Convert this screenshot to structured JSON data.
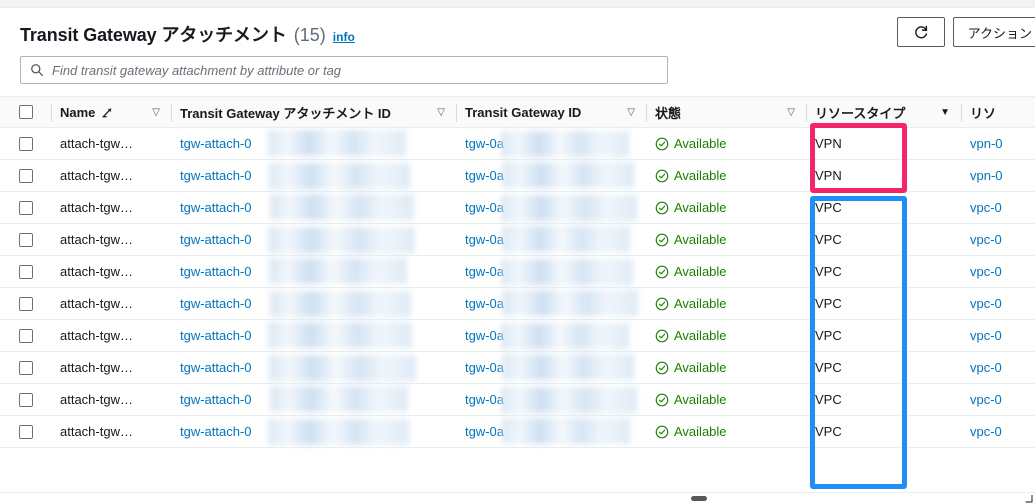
{
  "header": {
    "title": "Transit Gateway アタッチメント",
    "count": "(15)",
    "info_label": "info",
    "refresh_icon": "refresh-icon",
    "actions_label": "アクション"
  },
  "search": {
    "icon": "search-icon",
    "placeholder": "Find transit gateway attachment by attribute or tag",
    "value": ""
  },
  "table": {
    "select_all_label": "",
    "columns": [
      {
        "label": "Name",
        "sort": "▽",
        "sort_active": false,
        "has_pencil": true
      },
      {
        "label": "Transit Gateway アタッチメント ID",
        "sort": "▽",
        "sort_active": false,
        "has_pencil": false
      },
      {
        "label": "Transit Gateway ID",
        "sort": "▽",
        "sort_active": false,
        "has_pencil": false
      },
      {
        "label": "状態",
        "sort": "▽",
        "sort_active": false,
        "has_pencil": false
      },
      {
        "label": "リソースタイプ",
        "sort": "▼",
        "sort_active": true,
        "has_pencil": false
      },
      {
        "label": "リソ",
        "sort": "",
        "sort_active": false,
        "has_pencil": false
      }
    ],
    "rows": [
      {
        "name": "attach-tgw…",
        "attachment_id": "tgw-attach-0",
        "tgw_id": "tgw-0a",
        "state": "Available",
        "state_icon": "check-circle-icon",
        "resource_type": "VPN",
        "resource_id": "vpn-0"
      },
      {
        "name": "attach-tgw…",
        "attachment_id": "tgw-attach-0",
        "tgw_id": "tgw-0a",
        "state": "Available",
        "state_icon": "check-circle-icon",
        "resource_type": "VPN",
        "resource_id": "vpn-0"
      },
      {
        "name": "attach-tgw…",
        "attachment_id": "tgw-attach-0",
        "tgw_id": "tgw-0a",
        "state": "Available",
        "state_icon": "check-circle-icon",
        "resource_type": "VPC",
        "resource_id": "vpc-0"
      },
      {
        "name": "attach-tgw…",
        "attachment_id": "tgw-attach-0",
        "tgw_id": "tgw-0a",
        "state": "Available",
        "state_icon": "check-circle-icon",
        "resource_type": "VPC",
        "resource_id": "vpc-0"
      },
      {
        "name": "attach-tgw…",
        "attachment_id": "tgw-attach-0",
        "tgw_id": "tgw-0a",
        "state": "Available",
        "state_icon": "check-circle-icon",
        "resource_type": "VPC",
        "resource_id": "vpc-0"
      },
      {
        "name": "attach-tgw…",
        "attachment_id": "tgw-attach-0",
        "tgw_id": "tgw-0a",
        "state": "Available",
        "state_icon": "check-circle-icon",
        "resource_type": "VPC",
        "resource_id": "vpc-0"
      },
      {
        "name": "attach-tgw…",
        "attachment_id": "tgw-attach-0",
        "tgw_id": "tgw-0a",
        "state": "Available",
        "state_icon": "check-circle-icon",
        "resource_type": "VPC",
        "resource_id": "vpc-0"
      },
      {
        "name": "attach-tgw…",
        "attachment_id": "tgw-attach-0",
        "tgw_id": "tgw-0a",
        "state": "Available",
        "state_icon": "check-circle-icon",
        "resource_type": "VPC",
        "resource_id": "vpc-0"
      },
      {
        "name": "attach-tgw…",
        "attachment_id": "tgw-attach-0",
        "tgw_id": "tgw-0a",
        "state": "Available",
        "state_icon": "check-circle-icon",
        "resource_type": "VPC",
        "resource_id": "vpc-0"
      },
      {
        "name": "attach-tgw…",
        "attachment_id": "tgw-attach-0",
        "tgw_id": "tgw-0a",
        "state": "Available",
        "state_icon": "check-circle-icon",
        "resource_type": "VPC",
        "resource_id": "vpc-0"
      }
    ]
  },
  "annotations": [
    {
      "name": "vpn-highlight",
      "color": "#f5256a",
      "covers": "resource-type VPN rows 1-2"
    },
    {
      "name": "vpc-highlight",
      "color": "#1e8ff5",
      "covers": "resource-type VPC rows 3-10"
    }
  ],
  "colors": {
    "link": "#0073bb",
    "state_green": "#1d8102",
    "pink_box": "#f5256a",
    "blue_box": "#1e8ff5"
  }
}
